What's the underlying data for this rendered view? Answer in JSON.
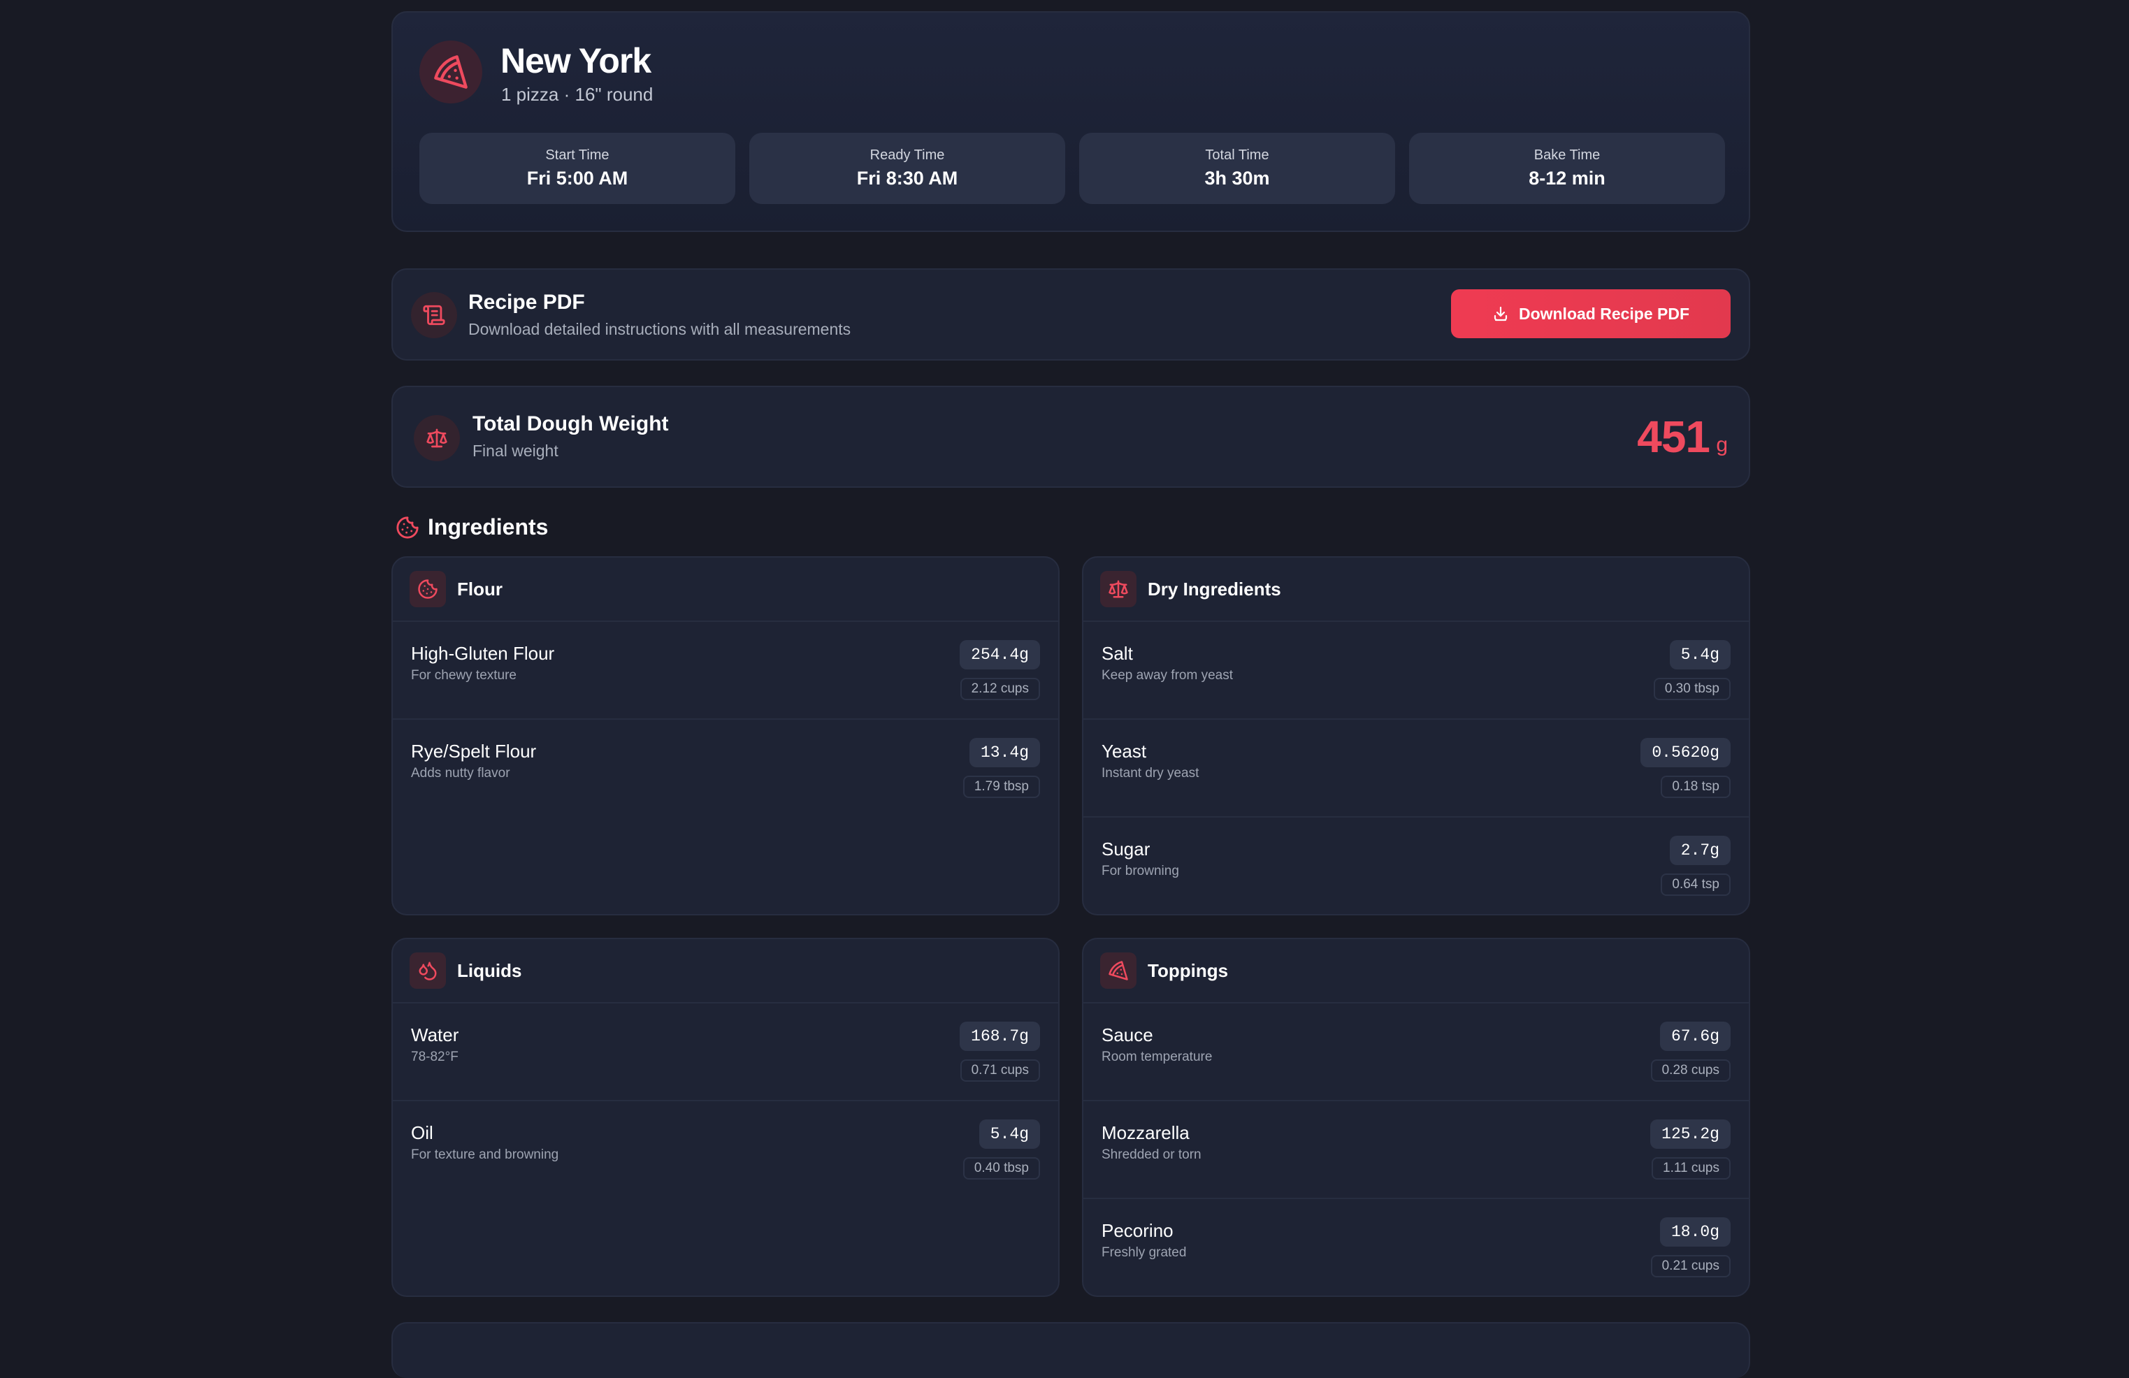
{
  "header": {
    "title": "New York",
    "subtitle": "1 pizza · 16\" round",
    "icon": "pizza-slice-icon",
    "times": [
      {
        "label": "Start Time",
        "value": "Fri 5:00 AM"
      },
      {
        "label": "Ready Time",
        "value": "Fri 8:30 AM"
      },
      {
        "label": "Total Time",
        "value": "3h 30m"
      },
      {
        "label": "Bake Time",
        "value": "8-12 min"
      }
    ]
  },
  "pdf": {
    "title": "Recipe PDF",
    "subtitle": "Download detailed instructions with all measurements",
    "button_label": "Download Recipe PDF",
    "icon": "scroll-icon"
  },
  "weight": {
    "title": "Total Dough Weight",
    "subtitle": "Final weight",
    "value": "451",
    "unit": "g",
    "icon": "scale-icon"
  },
  "ingredients": {
    "title": "Ingredients",
    "icon": "cookie-icon",
    "groups": [
      {
        "title": "Flour",
        "icon": "cookie-icon",
        "items": [
          {
            "name": "High-Gluten Flour",
            "note": "For chewy texture",
            "grams": "254.4g",
            "volume": "2.12 cups"
          },
          {
            "name": "Rye/Spelt Flour",
            "note": "Adds nutty flavor",
            "grams": "13.4g",
            "volume": "1.79 tbsp"
          }
        ]
      },
      {
        "title": "Dry Ingredients",
        "icon": "scale-icon",
        "items": [
          {
            "name": "Salt",
            "note": "Keep away from yeast",
            "grams": "5.4g",
            "volume": "0.30 tbsp"
          },
          {
            "name": "Yeast",
            "note": "Instant dry yeast",
            "grams": "0.5620g",
            "volume": "0.18 tsp"
          },
          {
            "name": "Sugar",
            "note": "For browning",
            "grams": "2.7g",
            "volume": "0.64 tsp"
          }
        ]
      },
      {
        "title": "Liquids",
        "icon": "droplets-icon",
        "items": [
          {
            "name": "Water",
            "note": "78-82°F",
            "grams": "168.7g",
            "volume": "0.71 cups"
          },
          {
            "name": "Oil",
            "note": "For texture and browning",
            "grams": "5.4g",
            "volume": "0.40 tbsp"
          }
        ]
      },
      {
        "title": "Toppings",
        "icon": "pizza-slice-icon",
        "items": [
          {
            "name": "Sauce",
            "note": "Room temperature",
            "grams": "67.6g",
            "volume": "0.28 cups"
          },
          {
            "name": "Mozzarella",
            "note": "Shredded or torn",
            "grams": "125.2g",
            "volume": "1.11 cups"
          },
          {
            "name": "Pecorino",
            "note": "Freshly grated",
            "grams": "18.0g",
            "volume": "0.21 cups"
          }
        ]
      }
    ]
  },
  "colors": {
    "accent": "#ef4a5e",
    "background": "#181a24",
    "panel": "#1e2334"
  }
}
